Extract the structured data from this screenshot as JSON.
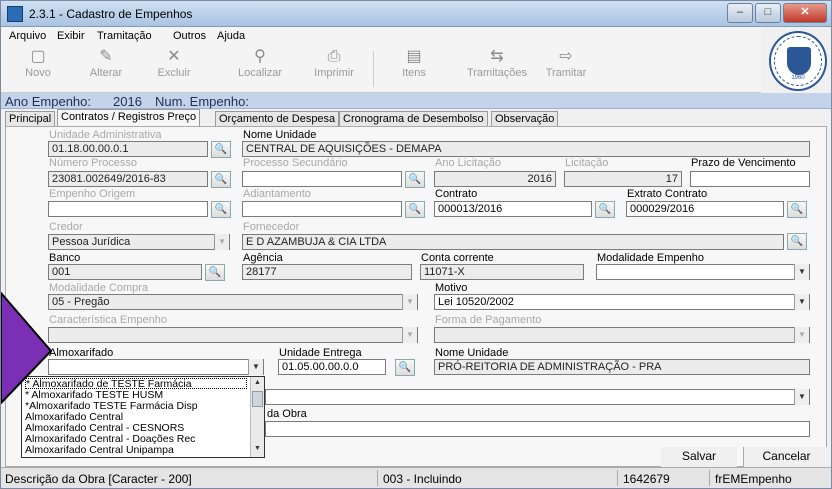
{
  "window": {
    "title": "2.3.1 - Cadastro de Empenhos",
    "min": "–",
    "max": "□",
    "close": "✕"
  },
  "menu": [
    "Arquivo",
    "Exibir",
    "Tramitação",
    "Outros",
    "Ajuda"
  ],
  "toolbar": [
    {
      "label": "Novo",
      "icon": "new-icon",
      "glyph": "▢"
    },
    {
      "label": "Alterar",
      "icon": "edit-icon",
      "glyph": "✎"
    },
    {
      "label": "Excluir",
      "icon": "delete-icon",
      "glyph": "✕"
    },
    {
      "label": "Localizar",
      "icon": "binoculars-icon",
      "glyph": "⚲"
    },
    {
      "label": "Imprimir",
      "icon": "printer-icon",
      "glyph": "⎙"
    },
    {
      "label": "Itens",
      "icon": "items-icon",
      "glyph": "▤"
    },
    {
      "label": "Tramitações",
      "icon": "tramitacoes-icon",
      "glyph": "⇆"
    },
    {
      "label": "Tramitar",
      "icon": "tramitar-icon",
      "glyph": "⇨"
    }
  ],
  "logo": {
    "year": "1960"
  },
  "header": {
    "ano_label": "Ano Empenho:",
    "ano_value": "2016",
    "num_label": "Num. Empenho:"
  },
  "tabs": [
    "Principal",
    "Contratos / Registros Preço",
    "Orçamento de Despesa",
    "Cronograma de Desembolso",
    "Observação"
  ],
  "form": {
    "unidade_adm_label": "Unidade Administrativa",
    "unidade_adm_value": "01.18.00.00.0.1",
    "nome_unidade_label": "Nome Unidade",
    "nome_unidade_value": "CENTRAL DE AQUISIÇÕES - DEMAPA",
    "num_processo_label": "Número Processo",
    "num_processo_value": "23081.002649/2016-83",
    "proc_secundario_label": "Processo Secundário",
    "proc_secundario_value": "",
    "ano_licitacao_label": "Ano Licitação",
    "ano_licitacao_value": "2016",
    "licitacao_label": "Licitação",
    "licitacao_value": "17",
    "prazo_label": "Prazo de Vencimento",
    "prazo_value": "",
    "empenho_origem_label": "Empenho Origem",
    "empenho_origem_value": "",
    "adiantamento_label": "Adiantamento",
    "adiantamento_value": "",
    "contrato_label": "Contrato",
    "contrato_value": "000013/2016",
    "extrato_label": "Extrato Contrato",
    "extrato_value": "000029/2016",
    "credor_label": "Credor",
    "credor_value": "Pessoa Jurídica",
    "fornecedor_label": "Fornecedor",
    "fornecedor_value": "E D AZAMBUJA & CIA LTDA",
    "banco_label": "Banco",
    "banco_value": "001",
    "agencia_label": "Agência",
    "agencia_value": "28177",
    "conta_label": "Conta corrente",
    "conta_value": "11071-X",
    "modalidade_emp_label": "Modalidade Empenho",
    "modalidade_emp_value": "",
    "modalidade_compra_label": "Modalidade Compra",
    "modalidade_compra_value": "05 - Pregão",
    "motivo_label": "Motivo",
    "motivo_value": "Lei 10520/2002",
    "caracteristica_label": "Característica Empenho",
    "caracteristica_value": "",
    "forma_pag_label": "Forma de Pagamento",
    "forma_pag_value": "",
    "almox_label": "Almoxarifado",
    "almox_value": "",
    "unidade_entrega_label": "Unidade Entrega",
    "unidade_entrega_value": "01.05.00.00.0.0",
    "nome_unidade2_label": "Nome Unidade",
    "nome_unidade2_value": "PRÓ-REITORIA DE ADMINISTRAÇÃO - PRA",
    "descricao_obra_label": "da Obra"
  },
  "almox_options": [
    "* Almoxarifado de TESTE Farmácia",
    "* Almoxarifado TESTE HUSM",
    "*Almoxarifado TESTE Farmácia Disp",
    "Almoxarifado Central",
    "Almoxarifado Central - CESNORS",
    "Almoxarifado Central - Doações Rec",
    "Almoxarifado Central Unipampa"
  ],
  "buttons": {
    "salvar": "Salvar",
    "cancelar": "Cancelar"
  },
  "status": {
    "field": "Descrição da Obra [Caracter - 200]",
    "mode": "003 - Incluindo",
    "id": "1642679",
    "form": "frEMEmpenho"
  },
  "colors": {
    "header_strip": "#c5d3ea",
    "annotation_arrow": "#7b2fb5"
  }
}
